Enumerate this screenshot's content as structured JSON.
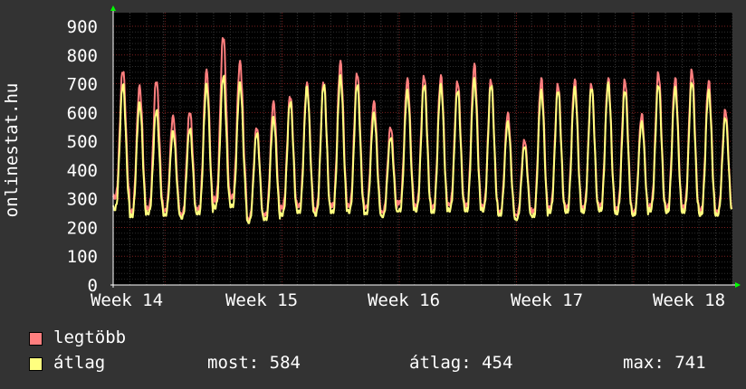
{
  "chart_data": {
    "type": "line",
    "ylabel": "onlinestat.hu",
    "ylim": [
      0,
      900
    ],
    "y_ticks": [
      0,
      100,
      200,
      300,
      400,
      500,
      600,
      700,
      800,
      900
    ],
    "x_ticks": [
      "Week 14",
      "Week 15",
      "Week 16",
      "Week 17",
      "Week 18"
    ],
    "grid": true,
    "days": 37,
    "series": [
      {
        "name": "legtöbb",
        "color": "#ff7f7f",
        "daily_peaks": [
          750,
          695,
          715,
          590,
          605,
          750,
          870,
          780,
          550,
          640,
          660,
          705,
          710,
          780,
          740,
          640,
          550,
          720,
          730,
          730,
          710,
          770,
          715,
          600,
          505,
          720,
          700,
          715,
          700,
          720,
          715,
          595,
          740,
          720,
          750,
          710,
          610
        ],
        "daily_lows": [
          300,
          250,
          260,
          255,
          240,
          260,
          290,
          300,
          225,
          240,
          265,
          270,
          255,
          270,
          270,
          265,
          250,
          280,
          270,
          265,
          275,
          270,
          270,
          250,
          240,
          250,
          265,
          265,
          265,
          270,
          260,
          250,
          270,
          265,
          265,
          255,
          250
        ]
      },
      {
        "name": "átlag",
        "color": "#ffff7f",
        "daily_peaks": [
          700,
          635,
          610,
          535,
          545,
          700,
          730,
          705,
          530,
          585,
          640,
          690,
          700,
          730,
          700,
          600,
          515,
          680,
          700,
          700,
          680,
          720,
          700,
          570,
          485,
          680,
          680,
          690,
          690,
          705,
          680,
          570,
          700,
          690,
          710,
          680,
          585
        ],
        "daily_lows": [
          260,
          235,
          245,
          240,
          230,
          245,
          265,
          270,
          215,
          225,
          240,
          250,
          240,
          250,
          250,
          245,
          235,
          255,
          255,
          250,
          255,
          255,
          255,
          240,
          225,
          235,
          250,
          250,
          250,
          255,
          245,
          240,
          255,
          250,
          250,
          240,
          240
        ]
      }
    ]
  },
  "legend": {
    "max_label": "legtöbb",
    "avg_label": "átlag",
    "stats": {
      "current": "most: 584",
      "average": "átlag: 454",
      "maximum": "max: 741"
    }
  }
}
